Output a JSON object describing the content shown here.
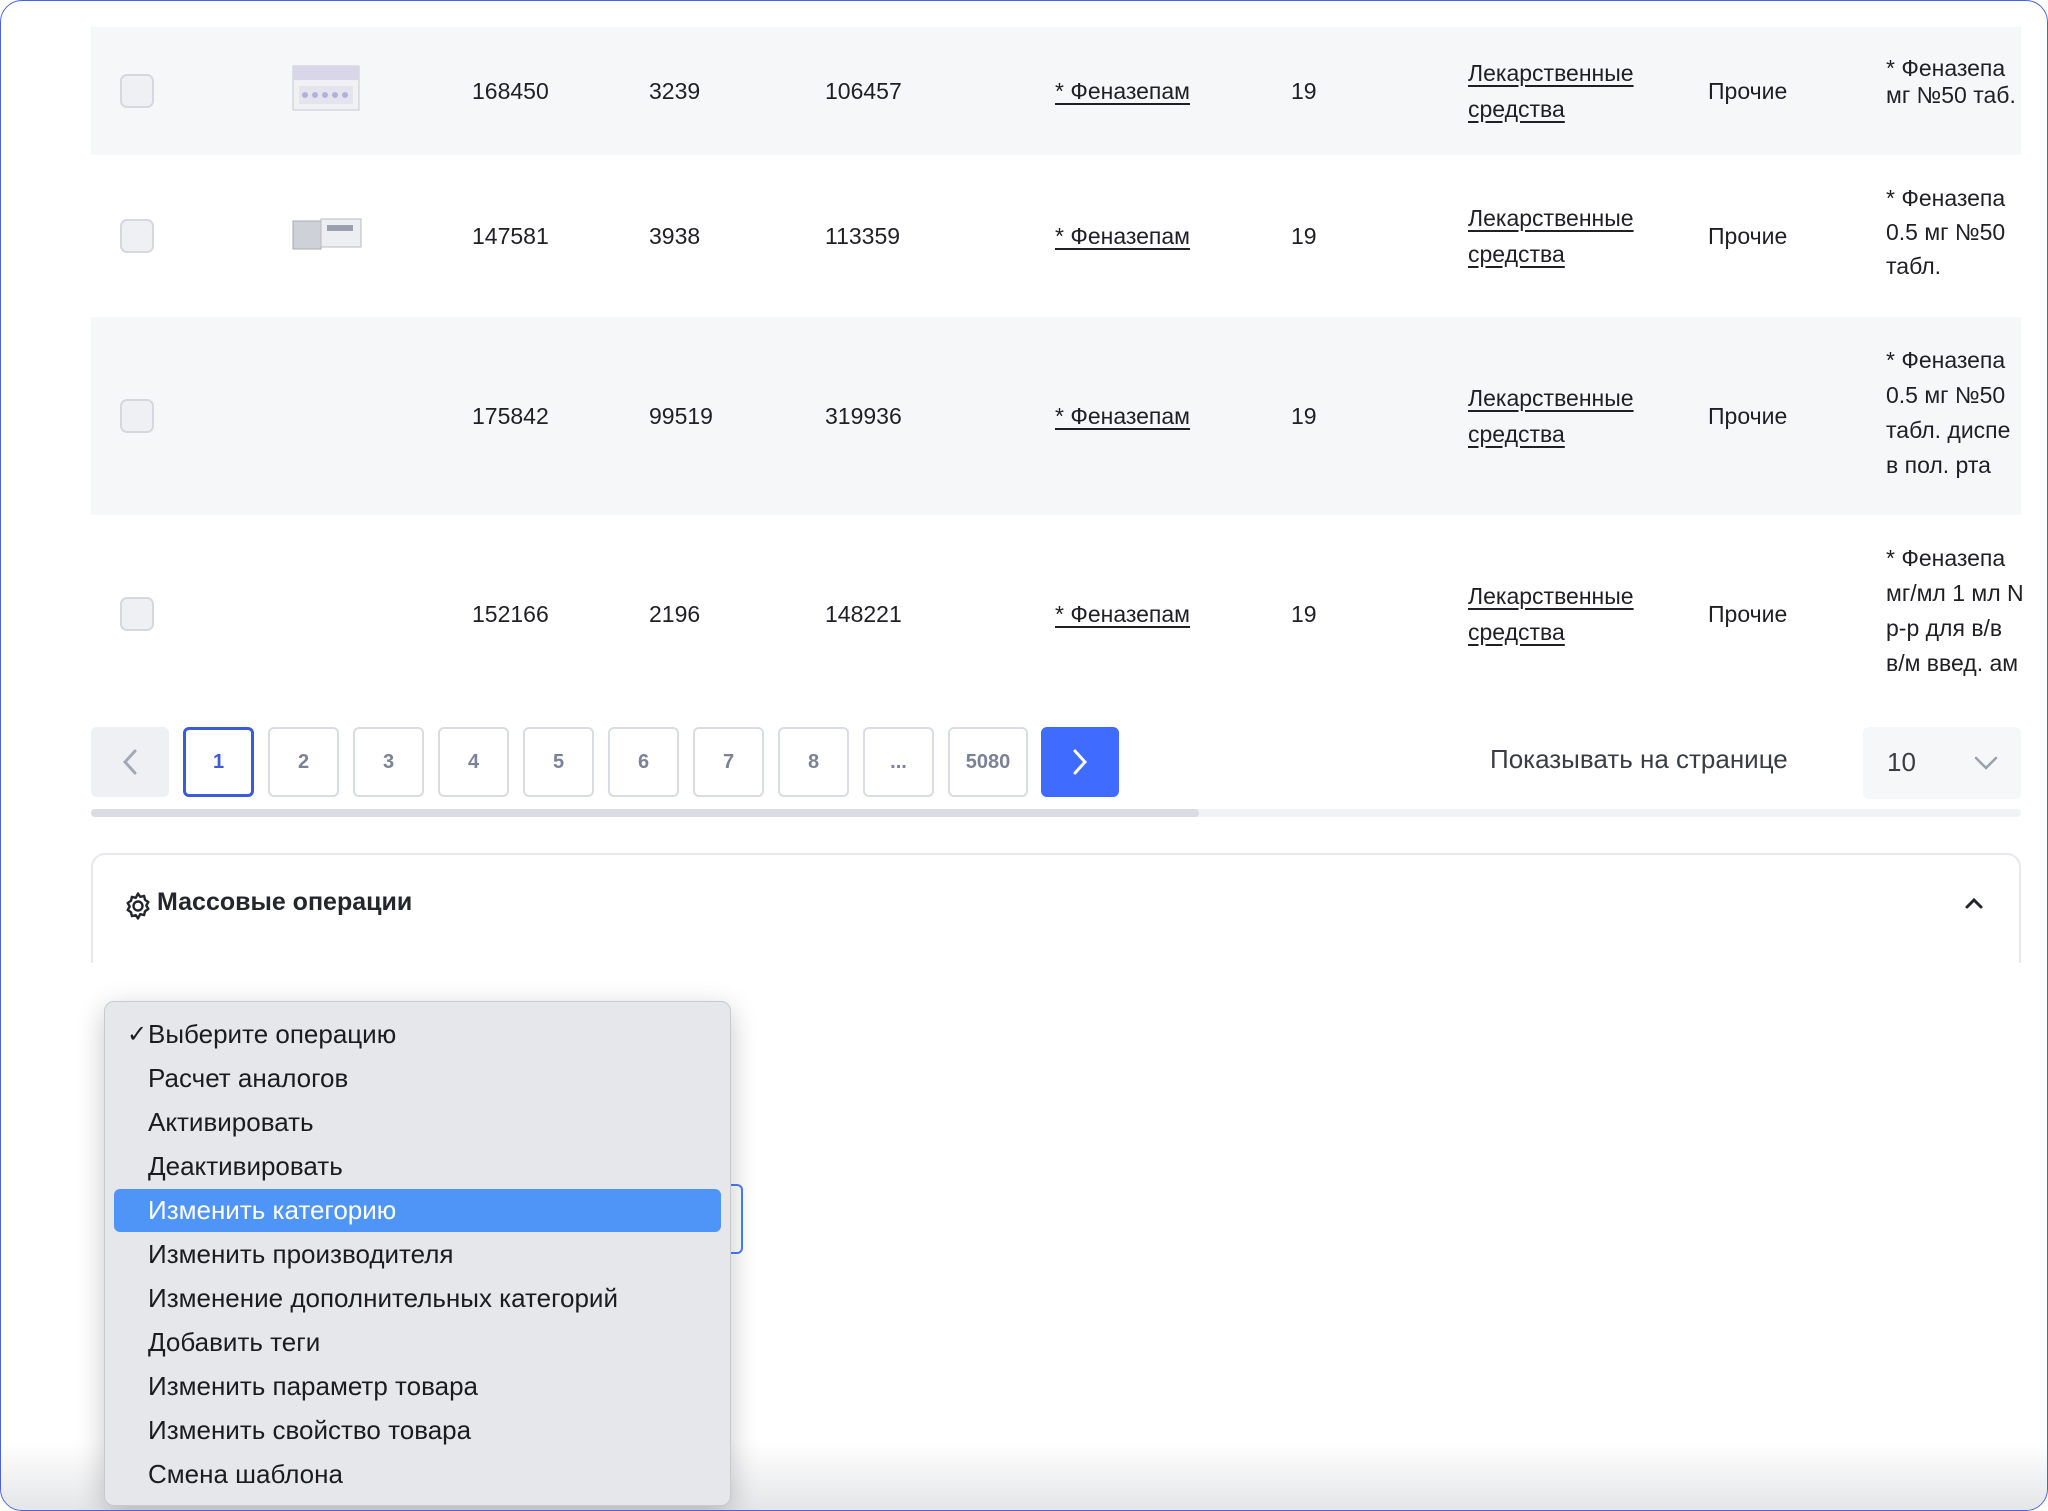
{
  "table": {
    "rows": [
      {
        "id": "168450",
        "code": "3239",
        "ext": "106457",
        "name": "* Феназепам",
        "count": "19",
        "category": "Лекарственные средства",
        "other": "Прочие",
        "full_name": "* Феназепа мг №50 таб."
      },
      {
        "id": "147581",
        "code": "3938",
        "ext": "113359",
        "name": "* Феназепам",
        "count": "19",
        "category": "Лекарственные средства",
        "other": "Прочие",
        "full_name": "* Феназепа 0.5 мг №50 табл."
      },
      {
        "id": "175842",
        "code": "99519",
        "ext": "319936",
        "name": "* Феназепам",
        "count": "19",
        "category": "Лекарственные средства",
        "other": "Прочие",
        "full_name": "* Феназепа 0.5 мг №50 табл. диспе в пол. рта"
      },
      {
        "id": "152166",
        "code": "2196",
        "ext": "148221",
        "name": "* Феназепам",
        "count": "19",
        "category": "Лекарственные средства",
        "other": "Прочие",
        "full_name": "* Феназепа мг/мл 1 мл N р-р для в/в в/м введ. ам"
      }
    ]
  },
  "pagination": {
    "pages": [
      "1",
      "2",
      "3",
      "4",
      "5",
      "6",
      "7",
      "8",
      "...",
      "5080"
    ],
    "current": "1",
    "per_page_label": "Показывать на странице",
    "per_page_value": "10"
  },
  "mass_operations": {
    "title": "Массовые операции",
    "icon": "gear-icon"
  },
  "operation_dropdown": {
    "options": [
      "Выберите операцию",
      "Расчет аналогов",
      "Активировать",
      "Деактивировать",
      "Изменить категорию",
      "Изменить производителя",
      "Изменение дополнительных категорий",
      "Добавить теги",
      "Изменить параметр товара",
      "Изменить свойство товара",
      "Смена шаблона"
    ],
    "checked_index": 0,
    "highlighted_index": 4,
    "check_mark": "✓"
  },
  "colors": {
    "accent": "#3f6bff",
    "highlight": "#4f95f7",
    "row_alt": "#f6f7f9"
  }
}
